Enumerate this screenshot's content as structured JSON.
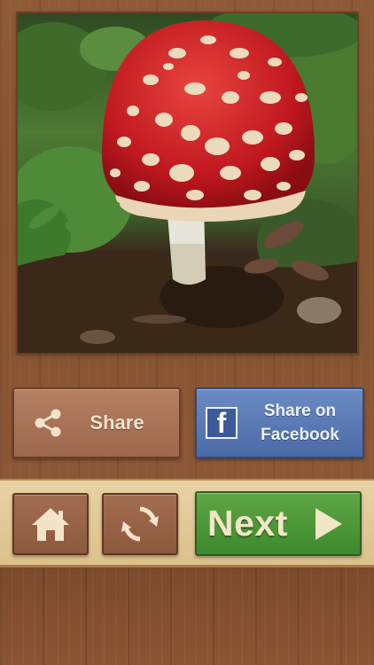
{
  "puzzle": {
    "image_alt": "Red fly agaric mushroom with white spots on forest floor"
  },
  "share": {
    "share_label": "Share",
    "share_icon": "share-icon",
    "facebook_line1": "Share on",
    "facebook_line2": "Facebook",
    "facebook_icon": "facebook-icon"
  },
  "toolbar": {
    "home_icon": "home-icon",
    "refresh_icon": "refresh-icon",
    "next_label": "Next",
    "next_icon": "play-arrow-icon"
  },
  "colors": {
    "wood": "#8a5535",
    "toolbar_bg": "#e8d2a4",
    "facebook_blue": "#4a6aa8",
    "next_green": "#4a9a36",
    "label_cream": "#f3e3c9"
  }
}
